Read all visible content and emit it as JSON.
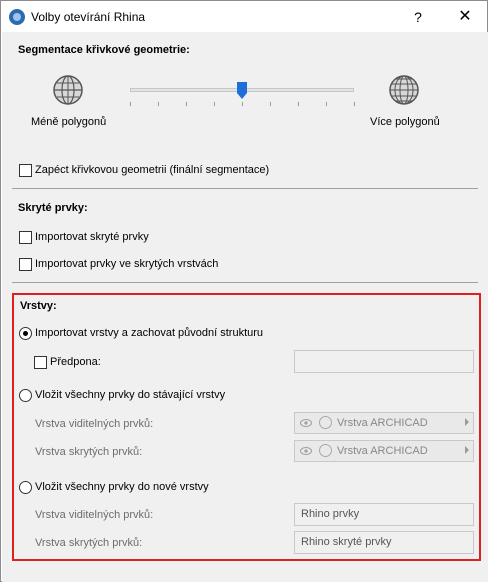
{
  "window": {
    "title": "Volby otevírání Rhina",
    "help_label": "?",
    "close_label": "✕"
  },
  "segmentation": {
    "heading": "Segmentace křivkové geometrie:",
    "left_label": "Méně polygonů",
    "right_label": "Více polygonů",
    "slider_level_fraction": 0.5
  },
  "bake_checkbox": {
    "label": "Zapéct křivkovou geometrii (finální segmentace)",
    "checked": false
  },
  "hidden": {
    "heading": "Skryté prvky:",
    "items": [
      {
        "label": "Importovat skryté prvky",
        "checked": false
      },
      {
        "label": "Importovat prvky ve skrytých vrstvách",
        "checked": false
      }
    ]
  },
  "layers": {
    "heading": "Vrstvy:",
    "option1": {
      "label": "Importovat vrstvy a zachovat původní strukturu",
      "selected": true
    },
    "prefix": {
      "label": "Předpona:",
      "checked": false,
      "value": ""
    },
    "option2": {
      "label": "Vložit všechny prvky do stávající vrstvy",
      "selected": false
    },
    "visible_layer": {
      "label": "Vrstva viditelných prvků:",
      "value": "Vrstva ARCHICAD"
    },
    "hidden_layer": {
      "label": "Vrstva skrytých prvků:",
      "value": "Vrstva ARCHICAD"
    },
    "option3": {
      "label": "Vložit všechny prvky do nové vrstvy",
      "selected": false
    },
    "new_visible": {
      "label": "Vrstva viditelných prvků:",
      "value": "Rhino prvky"
    },
    "new_hidden": {
      "label": "Vrstva skrytých prvků:",
      "value": "Rhino skryté prvky"
    }
  },
  "colors": {
    "highlight_border": "#e02020",
    "slider_thumb": "#1e6fd9"
  }
}
